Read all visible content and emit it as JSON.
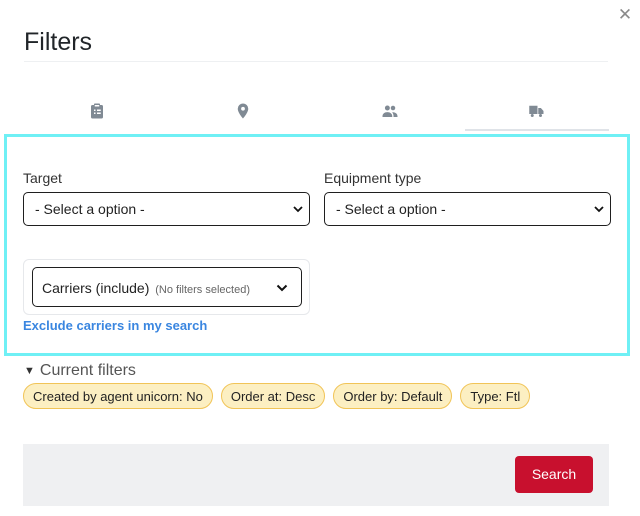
{
  "modal": {
    "title": "Filters",
    "close_icon": "close-icon"
  },
  "tabs": [
    {
      "icon": "clipboard-icon",
      "active": false
    },
    {
      "icon": "location-pin-icon",
      "active": false
    },
    {
      "icon": "people-icon",
      "active": false
    },
    {
      "icon": "truck-icon",
      "active": true
    }
  ],
  "form": {
    "target": {
      "label": "Target",
      "selected": "- Select a option -"
    },
    "equipment_type": {
      "label": "Equipment type",
      "selected": "- Select a option -"
    },
    "carriers": {
      "label": "Carriers (include)",
      "hint": "(No filters selected)"
    },
    "exclude_link": "Exclude carriers in my search"
  },
  "current_filters": {
    "label": "Current filters",
    "chips": [
      "Created by agent unicorn: No",
      "Order at: Desc",
      "Order by: Default",
      "Type: Ftl"
    ]
  },
  "footer": {
    "search_label": "Search"
  },
  "colors": {
    "highlight": "#6ff0f5",
    "chip_bg": "#fcefc2",
    "chip_border": "#f1c457",
    "primary": "#c8102e",
    "link": "#3a86e0"
  }
}
